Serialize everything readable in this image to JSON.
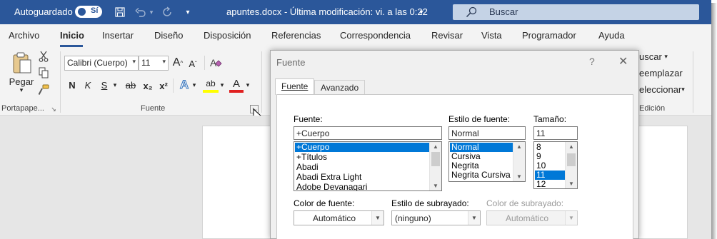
{
  "titlebar": {
    "autosave_label": "Autoguardado",
    "autosave_state": "Sí",
    "doc_title": "apuntes.docx  -  Última modificación: vi. a las 0:22",
    "search_placeholder": "Buscar",
    "color": "#2b579a"
  },
  "tabs": [
    "Archivo",
    "Inicio",
    "Insertar",
    "Diseño",
    "Disposición",
    "Referencias",
    "Correspondencia",
    "Revisar",
    "Vista",
    "Programador",
    "Ayuda"
  ],
  "active_tab": "Inicio",
  "ribbon": {
    "clipboard": {
      "paste_label": "Pegar",
      "group_label": "Portapape..."
    },
    "font": {
      "font_name": "Calibri (Cuerpo)",
      "font_size": "11",
      "grow_label": "A",
      "shrink_label": "A",
      "bold": "N",
      "italic": "K",
      "underline": "S",
      "strike": "ab",
      "subscript": "x₂",
      "superscript": "x²",
      "text_effects": "A",
      "highlight": "ab",
      "font_color": "A",
      "group_label": "Fuente"
    },
    "editing": {
      "find": "uscar",
      "replace": "eemplazar",
      "select": "eleccionar",
      "group_label": "Edición"
    }
  },
  "dialog": {
    "title": "Fuente",
    "help": "?",
    "tabs": [
      "Fuente",
      "Avanzado"
    ],
    "font_label": "Fuente:",
    "font_value": "+Cuerpo",
    "font_list": [
      "+Cuerpo",
      "+Títulos",
      "Abadi",
      "Abadi Extra Light",
      "Adobe Devanagari"
    ],
    "font_list_selected": "+Cuerpo",
    "style_label": "Estilo de fuente:",
    "style_value": "Normal",
    "style_list": [
      "Normal",
      "Cursiva",
      "Negrita",
      "Negrita Cursiva"
    ],
    "style_list_selected": "Normal",
    "size_label": "Tamaño:",
    "size_value": "11",
    "size_list": [
      "8",
      "9",
      "10",
      "11",
      "12"
    ],
    "size_list_selected": "11",
    "font_color_label": "Color de fuente:",
    "font_color_value": "Automático",
    "underline_style_label": "Estilo de subrayado:",
    "underline_style_value": "(ninguno)",
    "underline_color_label": "Color de subrayado:",
    "underline_color_value": "Automático"
  }
}
